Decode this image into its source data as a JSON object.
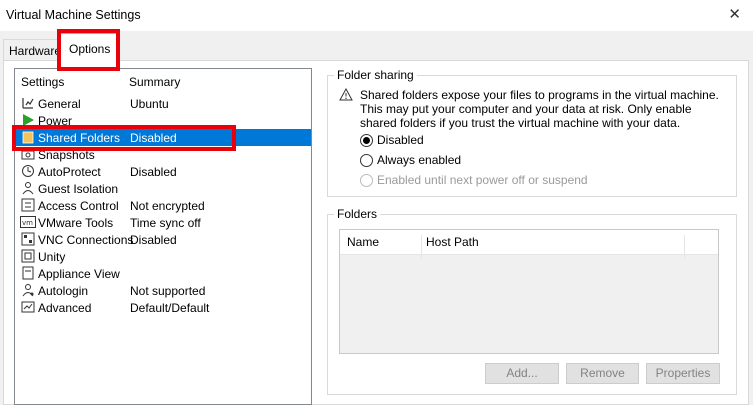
{
  "window": {
    "title": "Virtual Machine Settings",
    "close_glyph": "✕"
  },
  "tabs": [
    {
      "label": "Hardware"
    },
    {
      "label": "Options"
    }
  ],
  "settings_list": {
    "col_settings": "Settings",
    "col_summary": "Summary",
    "items": [
      {
        "label": "General",
        "summary": "Ubuntu",
        "icon": "general-icon"
      },
      {
        "label": "Power",
        "summary": "",
        "icon": "power-icon"
      },
      {
        "label": "Shared Folders",
        "summary": "Disabled",
        "icon": "shared-folders-icon"
      },
      {
        "label": "Snapshots",
        "summary": "",
        "icon": "snapshots-icon"
      },
      {
        "label": "AutoProtect",
        "summary": "Disabled",
        "icon": "autoprotect-icon"
      },
      {
        "label": "Guest Isolation",
        "summary": "",
        "icon": "guest-isolation-icon"
      },
      {
        "label": "Access Control",
        "summary": "Not encrypted",
        "icon": "access-control-icon"
      },
      {
        "label": "VMware Tools",
        "summary": "Time sync off",
        "icon": "vmware-tools-icon"
      },
      {
        "label": "VNC Connections",
        "summary": "Disabled",
        "icon": "vnc-icon"
      },
      {
        "label": "Unity",
        "summary": "",
        "icon": "unity-icon"
      },
      {
        "label": "Appliance View",
        "summary": "",
        "icon": "appliance-view-icon"
      },
      {
        "label": "Autologin",
        "summary": "Not supported",
        "icon": "autologin-icon"
      },
      {
        "label": "Advanced",
        "summary": "Default/Default",
        "icon": "advanced-icon"
      }
    ]
  },
  "folder_sharing": {
    "title": "Folder sharing",
    "warning_lines": [
      "Shared folders expose your files to programs in the virtual machine.",
      "This may put your computer and your data at risk. Only enable",
      "shared folders if you trust the virtual machine with your data."
    ],
    "options": [
      {
        "label": "Disabled",
        "selected": true,
        "enabled": true
      },
      {
        "label": "Always enabled",
        "selected": false,
        "enabled": true
      },
      {
        "label": "Enabled until next power off or suspend",
        "selected": false,
        "enabled": false
      }
    ]
  },
  "folders": {
    "title": "Folders",
    "col_name": "Name",
    "col_host_path": "Host Path",
    "buttons": {
      "add": "Add...",
      "remove": "Remove",
      "properties": "Properties"
    }
  },
  "colors": {
    "selection": "#0078d7",
    "highlight_box": "#e8000b"
  }
}
